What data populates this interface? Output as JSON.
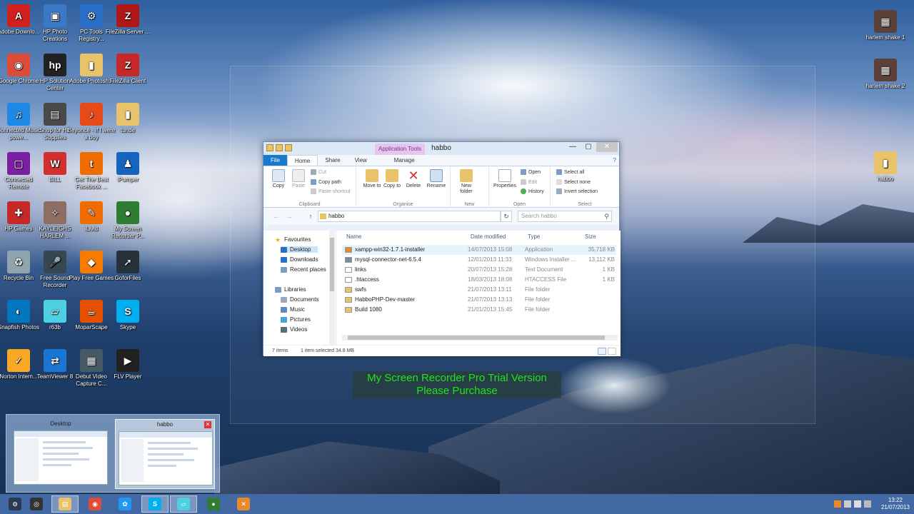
{
  "desktop_icons_left": [
    {
      "label": "Adobe Downlo...",
      "color": "#d12020",
      "glyph": "A"
    },
    {
      "label": "HP Photo Creations",
      "color": "#3a78c8",
      "glyph": "▣"
    },
    {
      "label": "PC Tools Registry...",
      "color": "#2a6fc7",
      "glyph": "⚙"
    },
    {
      "label": "FileZilla Server ...",
      "color": "#b01818",
      "glyph": "Z"
    },
    {
      "label": "Google Chrome",
      "color": "#dd4b39",
      "glyph": "◉"
    },
    {
      "label": "HP Solution Center",
      "color": "#222222",
      "glyph": "hp"
    },
    {
      "label": "Adobe Photosh...",
      "color": "#e8c36a",
      "glyph": "▮"
    },
    {
      "label": "FileZilla Client",
      "color": "#c62828",
      "glyph": "Z"
    },
    {
      "label": "Connected Music powe...",
      "color": "#1e88e5",
      "glyph": "♫"
    },
    {
      "label": "Shop for HP Supplies",
      "color": "#4a4a4a",
      "glyph": "▤"
    },
    {
      "label": "Beyoncé - If I were a boy",
      "color": "#e64a19",
      "glyph": "♪"
    },
    {
      "label": "tunde",
      "color": "#e8c36a",
      "glyph": "▮"
    },
    {
      "label": "Connected Remote",
      "color": "#7b1fa2",
      "glyph": "▢"
    },
    {
      "label": "BILL",
      "color": "#d32f2f",
      "glyph": "W"
    },
    {
      "label": "Get The Best Facebook ...",
      "color": "#ef6c00",
      "glyph": "t"
    },
    {
      "label": "iPumper",
      "color": "#1565c0",
      "glyph": "♟"
    },
    {
      "label": "HP Games",
      "color": "#c62828",
      "glyph": "✚"
    },
    {
      "label": "KAYLEIGHS HARLEM ...",
      "color": "#8d6e63",
      "glyph": "✧"
    },
    {
      "label": "iLivid",
      "color": "#ef6c00",
      "glyph": "✎"
    },
    {
      "label": "My Screen Recorder P...",
      "color": "#2e7d32",
      "glyph": "●"
    },
    {
      "label": "Recycle Bin",
      "color": "#90a4ae",
      "glyph": "♻"
    },
    {
      "label": "Free Sound Recorder",
      "color": "#37474f",
      "glyph": "🎤"
    },
    {
      "label": "Play Free Games",
      "color": "#f57c00",
      "glyph": "◆"
    },
    {
      "label": "GoforFiles",
      "color": "#263238",
      "glyph": "➚"
    },
    {
      "label": "Snapfish Photos",
      "color": "#0277bd",
      "glyph": "◐"
    },
    {
      "label": "r63b",
      "color": "#4dd0e1",
      "glyph": "▱"
    },
    {
      "label": "MoparScape",
      "color": "#e65100",
      "glyph": "☕"
    },
    {
      "label": "Skype",
      "color": "#00aff0",
      "glyph": "S"
    },
    {
      "label": "Norton Intern...",
      "color": "#f9a825",
      "glyph": "✓"
    },
    {
      "label": "TeamViewer 8",
      "color": "#1976d2",
      "glyph": "⇄"
    },
    {
      "label": "Debut Video Capture C...",
      "color": "#455a64",
      "glyph": "▦"
    },
    {
      "label": "FLV Player",
      "color": "#212121",
      "glyph": "▶"
    }
  ],
  "desktop_icons_right": [
    {
      "label": "harlem shake 1",
      "color": "#5d4037",
      "glyph": "▦"
    },
    {
      "label": "harlem shake 2",
      "color": "#5d4037",
      "glyph": "▦"
    },
    {
      "label": "habbo",
      "color": "#e8c36a",
      "glyph": "▮"
    }
  ],
  "window": {
    "title": "habbo",
    "context_tab": "Application Tools",
    "controls": {
      "minimize": "—",
      "maximize": "▢",
      "close": "✕"
    },
    "tabs": {
      "file": "File",
      "home": "Home",
      "share": "Share",
      "view": "View",
      "manage": "Manage",
      "help": "?"
    },
    "ribbon": {
      "copy": "Copy",
      "paste": "Paste",
      "cut": "Cut",
      "copy_path": "Copy path",
      "paste_shortcut": "Paste shortcut",
      "clipboard": "Clipboard",
      "move_to": "Move to",
      "copy_to": "Copy to",
      "delete": "Delete",
      "rename": "Rename",
      "organise": "Organise",
      "new_folder": "New folder",
      "new": "New",
      "properties": "Properties",
      "open": "Open",
      "edit": "Edit",
      "history": "History",
      "open_group": "Open",
      "select_all": "Select all",
      "select_none": "Select none",
      "invert_selection": "Invert selection",
      "select": "Select"
    },
    "address": {
      "path": "habbo",
      "search_placeholder": "Search habbo",
      "back": "←",
      "forward": "→",
      "up": "↑",
      "refresh": "↻",
      "search_icon": "⚲"
    },
    "nav": {
      "favourites": "Favourites",
      "desktop": "Desktop",
      "downloads": "Downloads",
      "recent_places": "Recent places",
      "libraries": "Libraries",
      "documents": "Documents",
      "music": "Music",
      "pictures": "Pictures",
      "videos": "Videos"
    },
    "columns": {
      "name": "Name",
      "date": "Date modified",
      "type": "Type",
      "size": "Size"
    },
    "files": [
      {
        "name": "xampp-win32-1.7.1-installer",
        "date": "14/07/2013 15:08",
        "type": "Application",
        "size": "35,718 KB",
        "icon_color": "#e8892a",
        "selected": true
      },
      {
        "name": "mysql-connector-net-6.5.4",
        "date": "12/01/2013 11:33",
        "type": "Windows Installer ...",
        "size": "13,112 KB",
        "icon_color": "#7a8aa0",
        "selected": false
      },
      {
        "name": "links",
        "date": "20/07/2013 15:28",
        "type": "Text Document",
        "size": "1 KB",
        "icon_color": "#ffffff",
        "selected": false
      },
      {
        "name": ".htaccess",
        "date": "18/03/2013 18:08",
        "type": "HTACCESS File",
        "size": "1 KB",
        "icon_color": "#ffffff",
        "selected": false
      },
      {
        "name": "swfs",
        "date": "21/07/2013 13:11",
        "type": "File folder",
        "size": "",
        "icon_color": "#e8c36a",
        "selected": false
      },
      {
        "name": "HabboPHP-Dev-master",
        "date": "21/07/2013 13:13",
        "type": "File folder",
        "size": "",
        "icon_color": "#e8c36a",
        "selected": false
      },
      {
        "name": "Build 1080",
        "date": "21/01/2013 15:45",
        "type": "File folder",
        "size": "",
        "icon_color": "#e8c36a",
        "selected": false
      }
    ],
    "status": {
      "items": "7 items",
      "selected": "1 item selected  34.8 MB"
    }
  },
  "watermark": {
    "line1": "My Screen Recorder Pro Trial Version",
    "line2": "Please Purchase"
  },
  "thumbnails": [
    {
      "title": "Desktop"
    },
    {
      "title": "habbo"
    }
  ],
  "taskbar": {
    "items": [
      {
        "name": "start-button",
        "glyph": "⊝",
        "color": "#2a3a55"
      },
      {
        "name": "recorder-app",
        "glyph": "◎",
        "color": "#333333"
      },
      {
        "name": "file-explorer",
        "glyph": "▤",
        "color": "#e8c36a"
      },
      {
        "name": "chrome",
        "glyph": "◉",
        "color": "#dd4b39"
      },
      {
        "name": "media-app",
        "glyph": "✿",
        "color": "#2196f3"
      },
      {
        "name": "skype",
        "glyph": "S",
        "color": "#00aff0"
      },
      {
        "name": "r63b",
        "glyph": "▱",
        "color": "#4dd0e1"
      },
      {
        "name": "my-screen-recorder",
        "glyph": "●",
        "color": "#2e7d32"
      },
      {
        "name": "xampp",
        "glyph": "✕",
        "color": "#e8892a"
      }
    ],
    "time": "13:22",
    "date": "21/07/2013"
  }
}
